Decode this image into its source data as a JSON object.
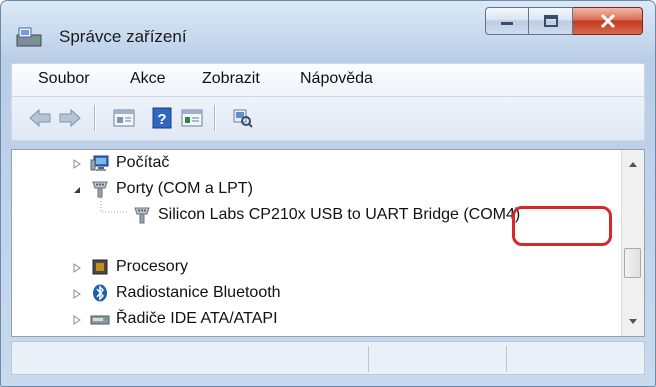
{
  "window": {
    "title": "Správce zařízení",
    "title_icon": "device-manager-icon",
    "controls": [
      "minimize",
      "maximize",
      "close"
    ]
  },
  "menu": {
    "items": [
      {
        "label": "Soubor"
      },
      {
        "label": "Akce"
      },
      {
        "label": "Zobrazit"
      },
      {
        "label": "Nápověda"
      }
    ]
  },
  "toolbar": {
    "buttons": [
      "back-arrow-icon",
      "forward-arrow-icon",
      "properties-icon",
      "help-icon",
      "show-hidden-icon",
      "scan-hardware-icon"
    ]
  },
  "tree": {
    "items": [
      {
        "label": "Počítač",
        "icon": "computer-icon",
        "state": "collapsed"
      },
      {
        "label": "Porty (COM a LPT)",
        "icon": "port-icon",
        "state": "expanded"
      },
      {
        "label": "Silicon Labs CP210x USB to UART Bridge (COM4)",
        "icon": "port-icon",
        "state": "leaf"
      },
      {
        "label": "Procesory",
        "icon": "processor-icon",
        "state": "collapsed"
      },
      {
        "label": "Radiostanice Bluetooth",
        "icon": "bluetooth-icon",
        "state": "collapsed"
      },
      {
        "label": "Řadiče IDE ATA/ATAPI",
        "icon": "ide-controller-icon",
        "state": "collapsed"
      }
    ],
    "annotation": "red-highlight-around-COM4"
  },
  "colors": {
    "highlight": "#d7262c",
    "close_button": "#c2391f"
  }
}
